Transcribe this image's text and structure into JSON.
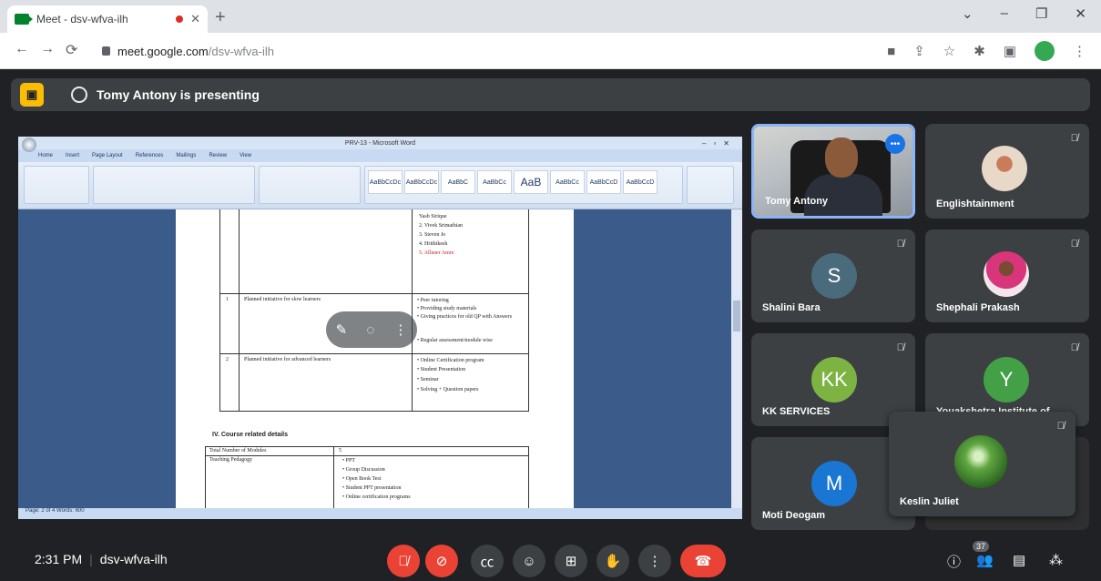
{
  "browser": {
    "tab_title": "Meet - dsv-wfva-ilh",
    "newtab": "+",
    "url_host": "meet.google.com",
    "url_path": "/dsv-wfva-ilh",
    "window_controls": [
      "⌄",
      "–",
      "❐",
      "✕"
    ],
    "nav": {
      "back": "←",
      "forward": "→",
      "reload": "⟳"
    }
  },
  "presenting": {
    "label": "Tomy Antony is presenting",
    "yellow_icon": "▣"
  },
  "word": {
    "title": "PRV-13 - Microsoft Word",
    "tabs": [
      "Home",
      "Insert",
      "Page Layout",
      "References",
      "Mailings",
      "Review",
      "View"
    ],
    "styles": [
      "AaBbCcDc",
      "AaBbCcDc",
      "AaBbC",
      "AaBbCc",
      "AaB",
      "AaBbCc",
      "AaBbCcD",
      "AaBbCcD"
    ],
    "upper_bullets": [
      "Yash Sirique",
      "2. Vivek Srimathian",
      "3. Steven Jo",
      "4. Hrithikesh",
      "5. Allister Amre"
    ],
    "row1": {
      "num": "1",
      "text": "Planned initiative for slow learners",
      "bullets": [
        "Peer tutoring",
        "Providing study materials",
        "Giving practices for old QP with Answers",
        "Regular assessment/module wise"
      ]
    },
    "row2": {
      "num": "2",
      "text": "Planned initiative for advanced learners",
      "bullets": [
        "Online Certification program",
        "Student Presentation",
        "Seminar",
        "Solving + Question papers"
      ]
    },
    "section_heading": "IV. Course related details",
    "lower": {
      "col1": [
        "Total Number of Modules",
        "Teaching Pedagogy"
      ],
      "col2_first": "5",
      "bullets": [
        "PPT",
        "Group Discussion",
        "Open Book Test",
        "Student PPT presentation",
        "Online certification programs"
      ]
    },
    "status": "Page: 2 of 4    Words: 600"
  },
  "overlay_icons": [
    "pin-icon",
    "mute-icon",
    "more-icon"
  ],
  "participants": [
    {
      "name": "Tomy Antony",
      "initial": "",
      "color": ""
    },
    {
      "name": "Englishtainment",
      "initial": "",
      "color": ""
    },
    {
      "name": "Shalini Bara",
      "initial": "S",
      "color": "#4a6b7c"
    },
    {
      "name": "Shephali Prakash",
      "initial": "",
      "color": ""
    },
    {
      "name": "KK SERVICES",
      "initial": "KK",
      "color": "#7cb342"
    },
    {
      "name": "Youakshetra Institute of ...",
      "initial": "Y",
      "color": "#43a047"
    },
    {
      "name": "Moti Deogam",
      "initial": "M",
      "color": "#1976d2"
    },
    {
      "name": "Keslin Juliet",
      "initial": "",
      "color": ""
    }
  ],
  "bottom": {
    "time": "2:31 PM",
    "meeting_code": "dsv-wfva-ilh",
    "participants_count": "37"
  },
  "colors": {
    "accent": "#8ab4f8",
    "end_call": "#ea4335",
    "presenting_icon": "#fbbc04"
  }
}
